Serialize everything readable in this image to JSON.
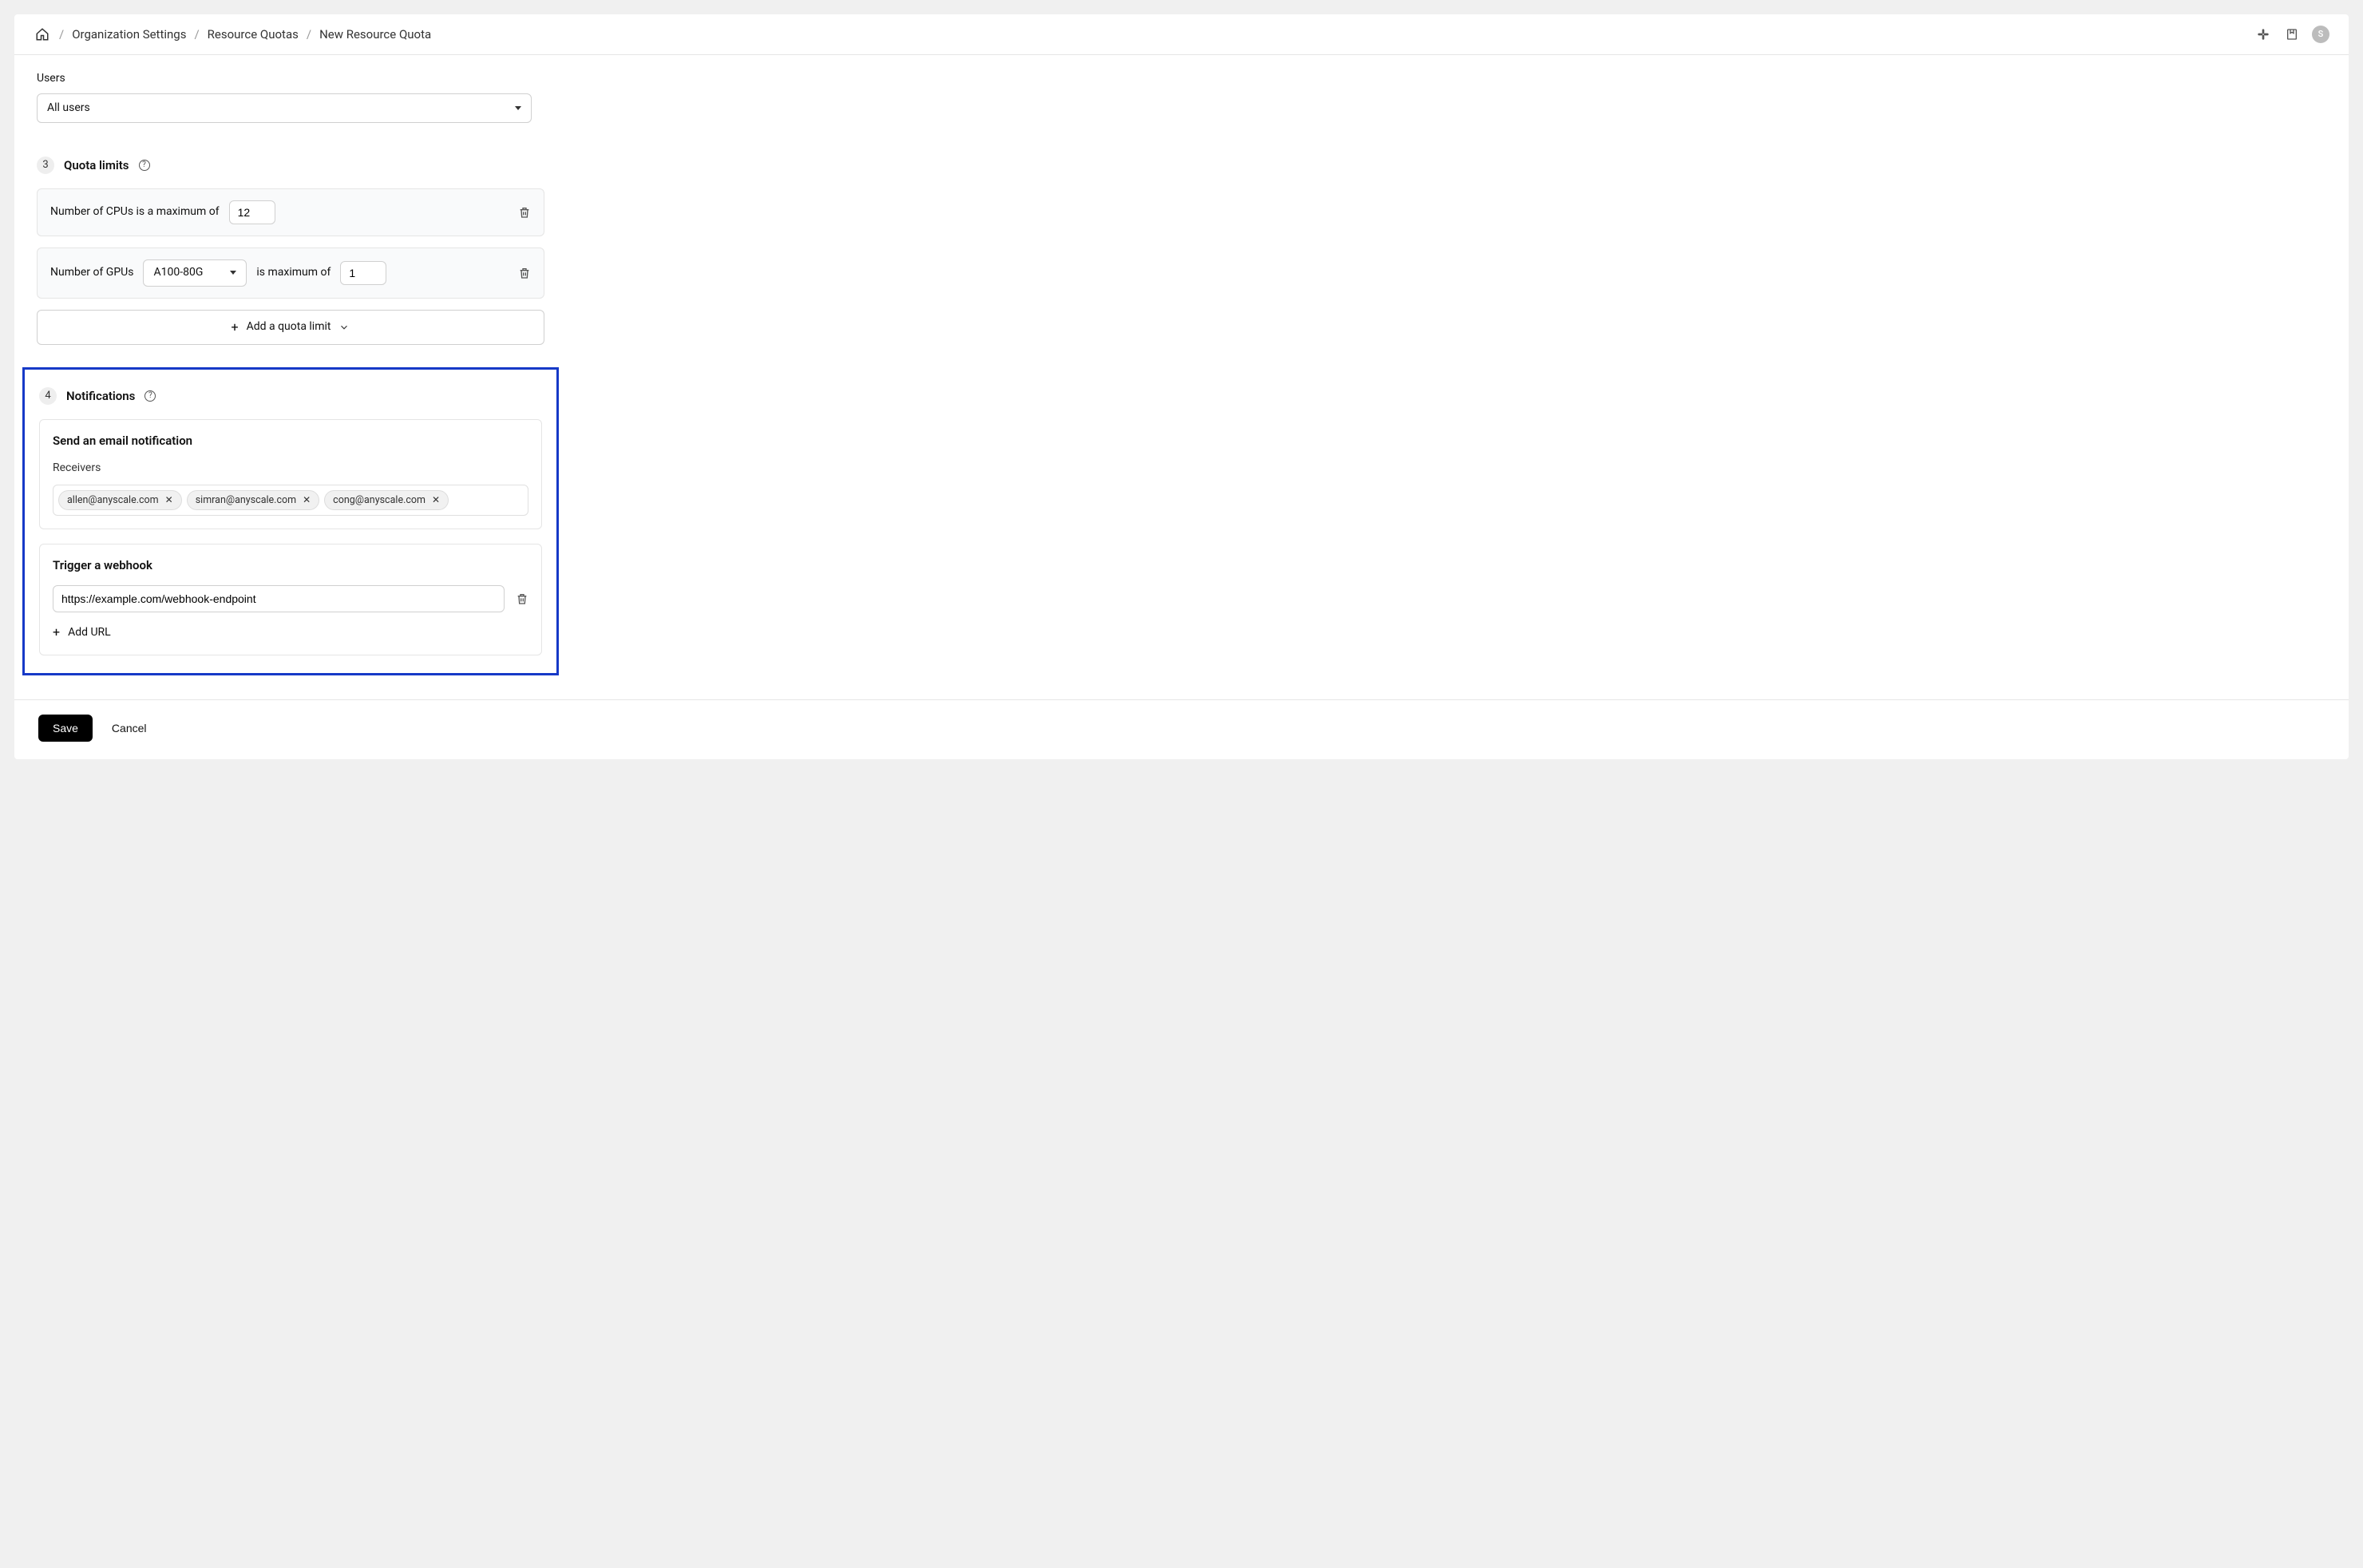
{
  "breadcrumbs": {
    "home": "Home",
    "org_settings": "Organization Settings",
    "resource_quotas": "Resource Quotas",
    "new_quota": "New Resource Quota"
  },
  "header_avatar": "S",
  "users": {
    "label": "Users",
    "selected": "All users"
  },
  "section3": {
    "step": "3",
    "title": "Quota limits",
    "cpu_prefix": "Number of CPUs is a maximum of",
    "cpu_value": "12",
    "gpu_prefix": "Number of GPUs",
    "gpu_type": "A100-80G",
    "gpu_mid": "is maximum of",
    "gpu_value": "1",
    "add_label": "Add a quota limit"
  },
  "section4": {
    "step": "4",
    "title": "Notifications",
    "email_card_title": "Send an email notification",
    "receivers_label": "Receivers",
    "receivers": [
      "allen@anyscale.com",
      "simran@anyscale.com",
      "cong@anyscale.com"
    ],
    "webhook_card_title": "Trigger a webhook",
    "webhook_url": "https://example.com/webhook-endpoint",
    "add_url_label": "Add URL"
  },
  "footer": {
    "save": "Save",
    "cancel": "Cancel"
  }
}
